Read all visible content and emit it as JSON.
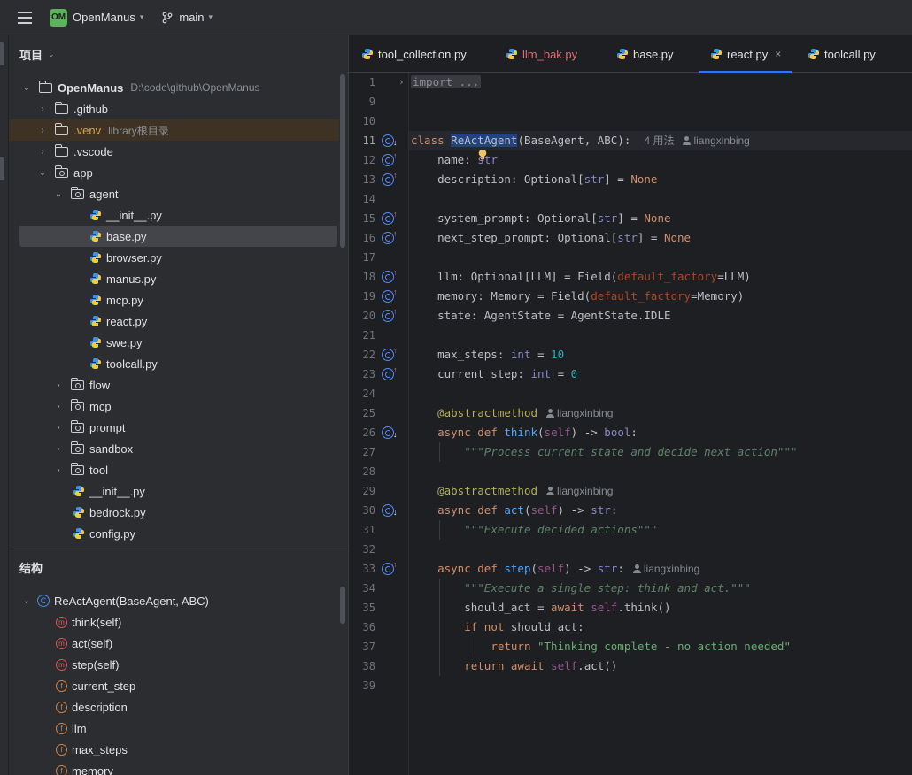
{
  "titlebar": {
    "project_badge": "OM",
    "project_name": "OpenManus",
    "branch": "main"
  },
  "project_panel": {
    "title": "项目",
    "root": {
      "label": "OpenManus",
      "path": "D:\\code\\github\\OpenManus"
    },
    "items": [
      {
        "label": ".github",
        "type": "folder"
      },
      {
        "label": ".venv",
        "type": "folder",
        "note": "library根目录"
      },
      {
        "label": ".vscode",
        "type": "folder"
      },
      {
        "label": "app",
        "type": "pkg"
      },
      {
        "label": "agent",
        "type": "pkg"
      },
      {
        "label": "__init__.py",
        "type": "py"
      },
      {
        "label": "base.py",
        "type": "py"
      },
      {
        "label": "browser.py",
        "type": "py"
      },
      {
        "label": "manus.py",
        "type": "py"
      },
      {
        "label": "mcp.py",
        "type": "py"
      },
      {
        "label": "react.py",
        "type": "py"
      },
      {
        "label": "swe.py",
        "type": "py"
      },
      {
        "label": "toolcall.py",
        "type": "py"
      },
      {
        "label": "flow",
        "type": "pkg"
      },
      {
        "label": "mcp",
        "type": "pkg"
      },
      {
        "label": "prompt",
        "type": "pkg"
      },
      {
        "label": "sandbox",
        "type": "pkg"
      },
      {
        "label": "tool",
        "type": "pkg"
      },
      {
        "label": "__init__.py",
        "type": "py"
      },
      {
        "label": "bedrock.py",
        "type": "py"
      },
      {
        "label": "config.py",
        "type": "py"
      }
    ]
  },
  "structure_panel": {
    "title": "结构",
    "class_label": "ReActAgent(BaseAgent, ABC)",
    "members": [
      {
        "label": "think(self)",
        "kind": "m"
      },
      {
        "label": "act(self)",
        "kind": "m"
      },
      {
        "label": "step(self)",
        "kind": "m"
      },
      {
        "label": "current_step",
        "kind": "f"
      },
      {
        "label": "description",
        "kind": "f"
      },
      {
        "label": "llm",
        "kind": "f"
      },
      {
        "label": "max_steps",
        "kind": "f"
      },
      {
        "label": "memory",
        "kind": "f"
      }
    ]
  },
  "tabs": [
    {
      "label": "tool_collection.py",
      "modified": false
    },
    {
      "label": "llm_bak.py",
      "modified": true
    },
    {
      "label": "base.py",
      "modified": false
    },
    {
      "label": "react.py",
      "modified": false,
      "active": true,
      "close": "×"
    },
    {
      "label": "toolcall.py",
      "modified": false
    }
  ],
  "editor": {
    "line_numbers": [
      "1",
      "9",
      "10",
      "11",
      "12",
      "13",
      "14",
      "15",
      "16",
      "17",
      "18",
      "19",
      "20",
      "21",
      "22",
      "23",
      "24",
      "25",
      "26",
      "27",
      "28",
      "29",
      "30",
      "31",
      "32",
      "33",
      "34",
      "35",
      "36",
      "37",
      "38",
      "39"
    ],
    "hints": {
      "usages": "4 用法",
      "author": "liangxinbing"
    },
    "strings": {
      "import_fold": "import ...",
      "doc_think": "\"\"\"Process current state and decide next action\"\"\"",
      "doc_act": "\"\"\"Execute decided actions\"\"\"",
      "doc_step": "\"\"\"Execute a single step: think and act.\"\"\"",
      "return_msg": "\"Thinking complete - no action needed\""
    }
  },
  "colors": {
    "accent": "#3574f0",
    "badge_green": "#5fb25d",
    "keyword": "#cf8e6d",
    "docstring": "#5f826b",
    "string": "#6aab73"
  }
}
